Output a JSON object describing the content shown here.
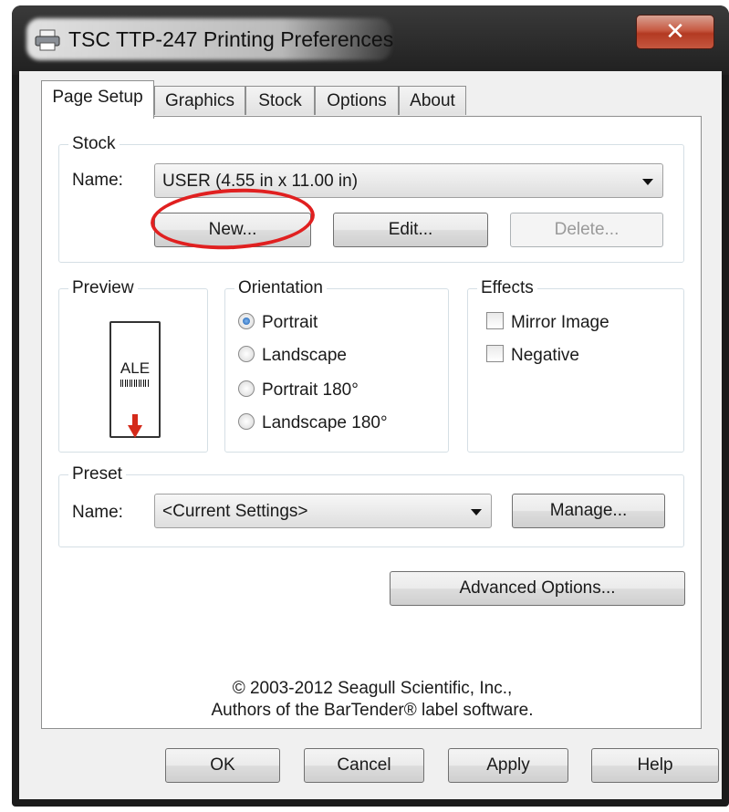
{
  "window": {
    "title": "TSC TTP-247 Printing Preferences",
    "close_glyph": "✕"
  },
  "tabs": [
    {
      "label": "Page Setup",
      "active": true
    },
    {
      "label": "Graphics",
      "active": false
    },
    {
      "label": "Stock",
      "active": false
    },
    {
      "label": "Options",
      "active": false
    },
    {
      "label": "About",
      "active": false
    }
  ],
  "stock": {
    "group_label": "Stock",
    "name_label": "Name:",
    "selected": "USER (4.55 in x 11.00 in)",
    "new_button": "New...",
    "edit_button": "Edit...",
    "delete_button": "Delete..."
  },
  "preview": {
    "group_label": "Preview",
    "label_text": "ALE"
  },
  "orientation": {
    "group_label": "Orientation",
    "options": [
      {
        "label": "Portrait",
        "checked": true
      },
      {
        "label": "Landscape",
        "checked": false
      },
      {
        "label": "Portrait 180°",
        "checked": false
      },
      {
        "label": "Landscape 180°",
        "checked": false
      }
    ]
  },
  "effects": {
    "group_label": "Effects",
    "options": [
      {
        "label": "Mirror Image",
        "checked": false
      },
      {
        "label": "Negative",
        "checked": false
      }
    ]
  },
  "preset": {
    "group_label": "Preset",
    "name_label": "Name:",
    "selected": "<Current Settings>",
    "manage_button": "Manage..."
  },
  "advanced_button": "Advanced Options...",
  "copyright": {
    "line1": "© 2003-2012 Seagull Scientific, Inc.,",
    "line2": "Authors of the BarTender® label software."
  },
  "dialog_buttons": {
    "ok": "OK",
    "cancel": "Cancel",
    "apply": "Apply",
    "help": "Help"
  },
  "colors": {
    "highlight_circle": "#e02020",
    "close_button": "#c75a43"
  },
  "icons": {
    "title": "printer-icon",
    "close": "close-icon",
    "dropdown": "chevron-down-icon",
    "preview_arrow": "arrow-down-icon"
  }
}
